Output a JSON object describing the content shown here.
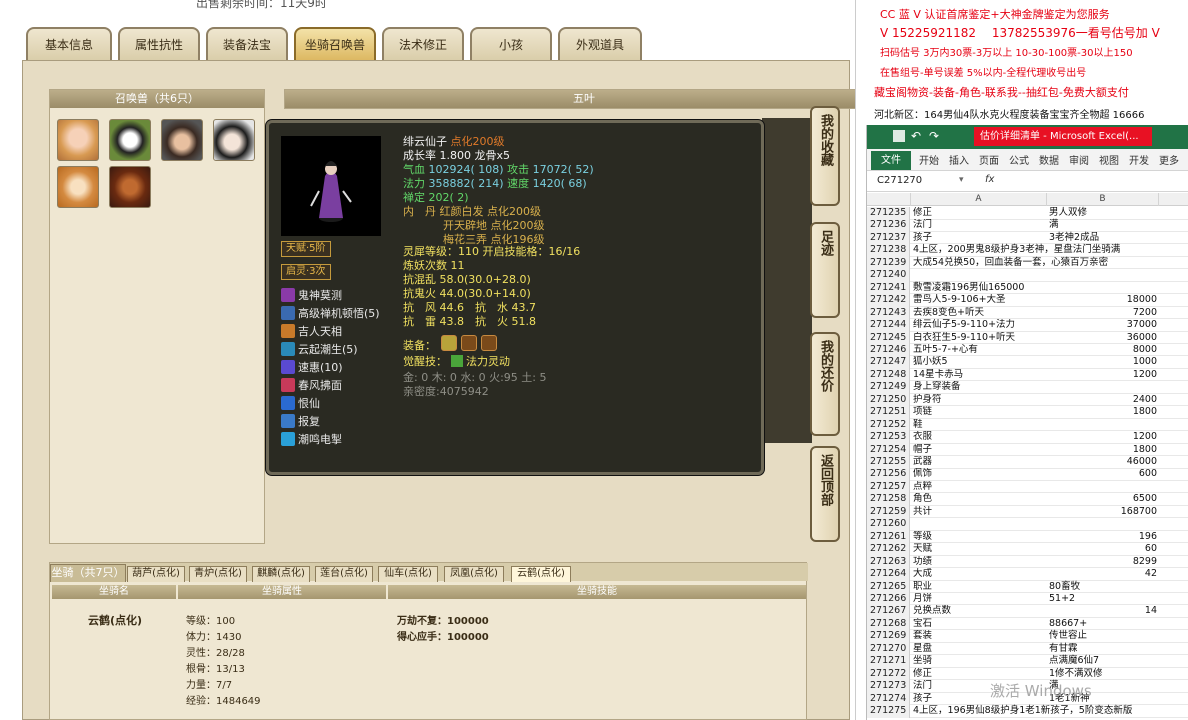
{
  "game": {
    "top_text": "出售剩余时间：11天9时",
    "tabs": [
      "基本信息",
      "属性抗性",
      "装备法宝",
      "坐骑召唤兽",
      "法术修正",
      "小孩",
      "外观道具"
    ],
    "active_tab": 3,
    "summon_header": "召唤兽（共6只）",
    "selected_name_header": "五叶",
    "side_buttons": [
      "我的收藏",
      "足迹",
      "我的还价",
      "返回顶部"
    ],
    "tooltip": {
      "name": "绯云仙子",
      "name_suffix": "点化200级",
      "growth": "成长率 1.800 龙骨x5",
      "hp_label": "气血",
      "hp": "102924( 108)",
      "atk_label": "攻击",
      "atk": "17072( 52)",
      "mp_label": "法力",
      "mp": "358882( 214)",
      "spd_label": "速度",
      "spd": "1420( 68)",
      "zen": "禅定 202( 2)",
      "inner_label": "内　丹",
      "inner1": "红颜白发 点化200级",
      "inner2": "开天辟地 点化200级",
      "inner3": "梅花三弄 点化196级",
      "badge1": "天赋·5阶",
      "badge2": "启灵·3次",
      "spirit": "灵犀等级：110  开启技能格：16/16",
      "refine": "炼妖次数 11",
      "res1": "抗混乱 58.0(30.0+28.0)",
      "res2": "抗鬼火 44.0(30.0+14.0)",
      "res3a": "抗　风 44.6",
      "res3b": "抗　水 43.7",
      "res4a": "抗　雷 43.8",
      "res4b": "抗　火 51.8",
      "equip_label": "装备：",
      "awaken_label": "觉醒技：",
      "awaken_skill": "法力灵动",
      "elements": "金: 0  木: 0  水: 0  火:95  土: 5",
      "intimacy": "亲密度:4075942",
      "skills": [
        "鬼神莫测",
        "高级禅机顿悟(5)",
        "吉人天相",
        "云起潮生(5)",
        "速惠(10)",
        "春风拂面",
        "恨仙",
        "报复",
        "潮鸣电掣"
      ]
    },
    "mount": {
      "header": "坐骑（共7只）",
      "tabs": [
        "葫芦(点化)",
        "青炉(点化)",
        "麒麟(点化)",
        "莲台(点化)",
        "仙车(点化)",
        "凤凰(点化)",
        "云鹤(点化)"
      ],
      "active_tab": 6,
      "col_headers": [
        "坐骑名",
        "坐骑属性",
        "坐骑技能"
      ],
      "name": "云鹤(点化)",
      "stats": [
        "等级：100",
        "体力：1430",
        "灵性：28/28",
        "根骨：13/13",
        "力量：7/7",
        "经验：1484649"
      ],
      "skills": [
        "万劫不复：100000",
        "得心应手：100000"
      ]
    }
  },
  "ads": [
    {
      "text": "CC 蓝 V 认证首席鉴定+大神金牌鉴定为您服务",
      "color": "#e60012"
    },
    {
      "text": "V 15225921182　 13782553976一看号估号加 V",
      "color": "#e60012"
    },
    {
      "text": "扫码估号 3万内30票-3万以上 10-30-100票-30以上150",
      "color": "#e60012"
    },
    {
      "text": "在售组号-单号误差 5%以内-全程代理收号出号",
      "color": "#e60012"
    },
    {
      "text": "藏宝阁物资-装备-角色-联系我--抽红包-免费大额支付",
      "color": "#e60012"
    },
    {
      "text": "河北新区：164男仙4队水克火程度装备宝宝齐全物超 16666",
      "color": "#111111"
    }
  ],
  "excel": {
    "title": "估价详细清单 - Microsoft Excel(...",
    "ribbon_tabs": [
      "文件",
      "开始",
      "插入",
      "页面",
      "公式",
      "数据",
      "审阅",
      "视图",
      "开发",
      "更多"
    ],
    "cell_ref": "C271270",
    "fx": "fx",
    "col_a": "A",
    "col_b": "B",
    "rows": [
      [
        "271235",
        "修正",
        "男人双修"
      ],
      [
        "271236",
        "法门",
        "满"
      ],
      [
        "271237",
        "孩子",
        "3老神2成品"
      ],
      [
        "271238",
        "4上区，200男鬼8级护身3老神，星盘法门坐骑满",
        ""
      ],
      [
        "271239",
        "大成54兑换50，回血装备一套，心猿百万亲密",
        ""
      ],
      [
        "271240",
        "",
        ""
      ],
      [
        "271241",
        "敷雪凌霜196男仙165000",
        ""
      ],
      [
        "271242",
        "雷鸟人5-9-106+大圣",
        "18000"
      ],
      [
        "271243",
        "去疾8变色+听天",
        "7200"
      ],
      [
        "271244",
        "绯云仙子5-9-110+法力",
        "37000"
      ],
      [
        "271245",
        "白衣狂生5-9-110+听天",
        "36000"
      ],
      [
        "271246",
        "五叶5-7-+心有",
        "8000"
      ],
      [
        "271247",
        "狐小妖5",
        "1000"
      ],
      [
        "271248",
        "14星卡赤马",
        "1200"
      ],
      [
        "271249",
        "身上穿装备",
        ""
      ],
      [
        "271250",
        "护身符",
        "2400"
      ],
      [
        "271251",
        "项链",
        "1800"
      ],
      [
        "271252",
        "鞋",
        ""
      ],
      [
        "271253",
        "衣服",
        "1200"
      ],
      [
        "271254",
        "帽子",
        "1800"
      ],
      [
        "271255",
        "武器",
        "46000"
      ],
      [
        "271256",
        "佩饰",
        "600"
      ],
      [
        "271257",
        "点粹",
        ""
      ],
      [
        "271258",
        "角色",
        "6500"
      ],
      [
        "271259",
        "共计",
        "168700"
      ],
      [
        "271260",
        "",
        ""
      ],
      [
        "271261",
        "等级",
        "196"
      ],
      [
        "271262",
        "天赋",
        "60"
      ],
      [
        "271263",
        "功绩",
        "8299"
      ],
      [
        "271264",
        "大成",
        "42"
      ],
      [
        "271265",
        "职业",
        "80畜牧"
      ],
      [
        "271266",
        "月饼",
        "51+2"
      ],
      [
        "271267",
        "兑换点数",
        "14"
      ],
      [
        "271268",
        "宝石",
        "88667+"
      ],
      [
        "271269",
        "套装",
        "传世容止"
      ],
      [
        "271270",
        "星盘",
        "有甘霖"
      ],
      [
        "271271",
        "坐骑",
        "点满魔6仙7"
      ],
      [
        "271272",
        "修正",
        "1修不满双修"
      ],
      [
        "271273",
        "法门",
        "满"
      ],
      [
        "271274",
        "孩子",
        "1老1新神"
      ],
      [
        "271275",
        "4上区，196男仙8级护身1老1新孩子，5阶变态新版",
        ""
      ]
    ],
    "watermark": "激活 Windows"
  }
}
